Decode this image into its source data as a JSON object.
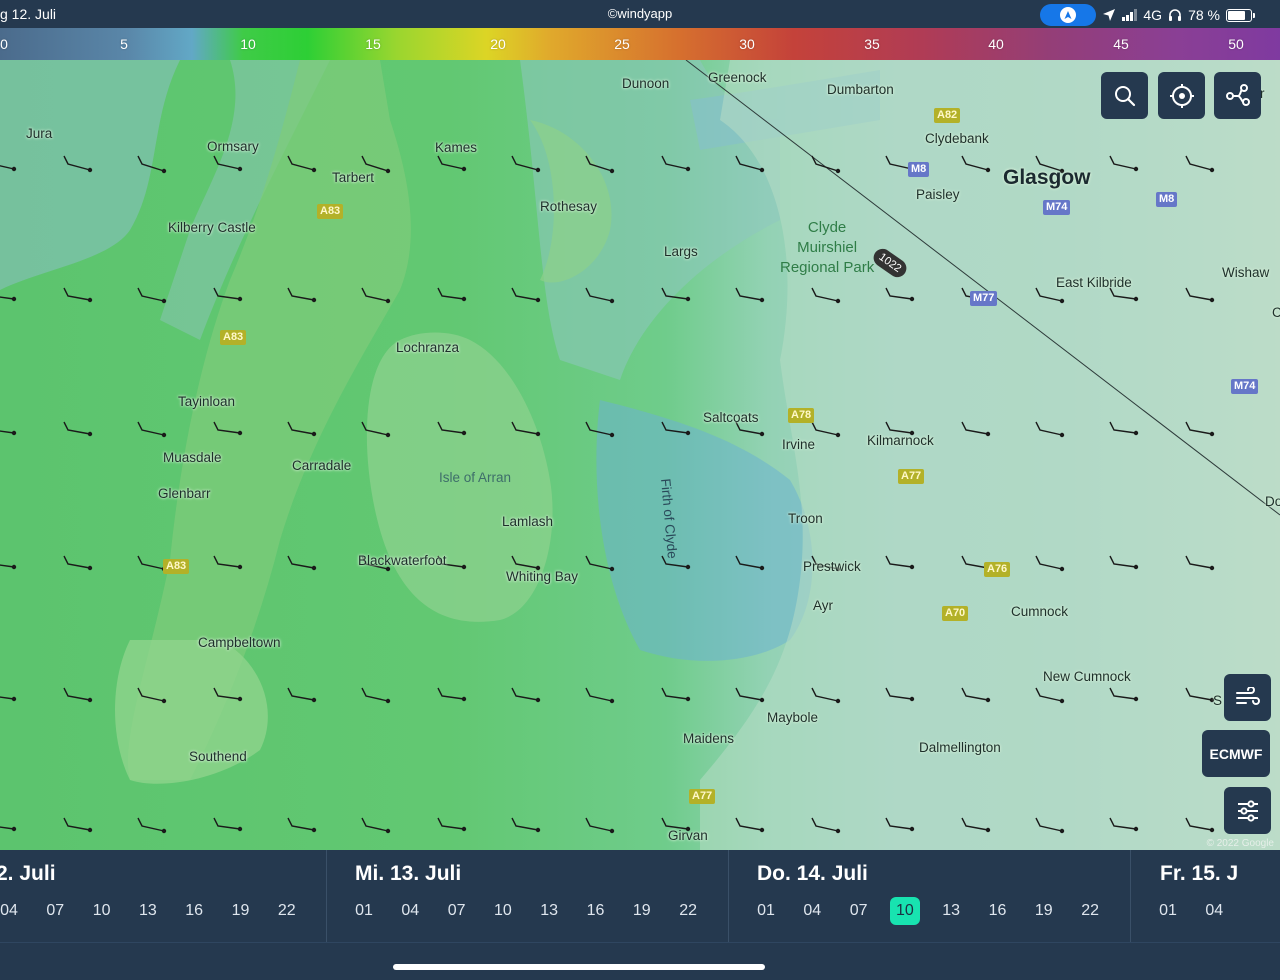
{
  "status_bar": {
    "date": "g 12. Juli",
    "brand": "©windyapp",
    "network": "4G",
    "battery": "78 %",
    "battery_level": 0.78
  },
  "legend": {
    "unit_hint": "",
    "ticks": [
      "0",
      "5",
      "10",
      "15",
      "20",
      "25",
      "30",
      "35",
      "40",
      "45",
      "50"
    ]
  },
  "map": {
    "places": {
      "jura": "Jura",
      "ormsary": "Ormsary",
      "tarbert": "Tarbert",
      "kames": "Kames",
      "dunoon": "Dunoon",
      "greenock": "Greenock",
      "dumbarton": "Dumbarton",
      "clydebank": "Clydebank",
      "glasgow": "Glasgow",
      "paisley": "Paisley",
      "rothesay": "Rothesay",
      "kilberry": "Kilberry Castle",
      "largs": "Largs",
      "park": "Clyde\nMuirshiel\nRegional Park",
      "east_kilbride": "East Kilbride",
      "wishaw": "Wishaw",
      "lochranza": "Lochranza",
      "tayinloan": "Tayinloan",
      "saltcoats": "Saltcoats",
      "irvine": "Irvine",
      "kilmarnock": "Kilmarnock",
      "muasdale": "Muasdale",
      "carradale": "Carradale",
      "arran": "Isle of Arran",
      "glenbarr": "Glenbarr",
      "lamlash": "Lamlash",
      "firth": "Firth of Clyde",
      "troon": "Troon",
      "blackwaterfoot": "Blackwaterfoot",
      "whiting_bay": "Whiting Bay",
      "prestwick": "Prestwick",
      "ayr": "Ayr",
      "cumnock": "Cumnock",
      "campbeltown": "Campbeltown",
      "new_cumnock": "New Cumnock",
      "maybole": "Maybole",
      "maidens": "Maidens",
      "dalmellington": "Dalmellington",
      "southend": "Southend",
      "girvan": "Girvan",
      "edge_do": "Do",
      "edge_s": "S",
      "edge_c": "C",
      "edge_r": "r"
    },
    "roads": {
      "a82": "A82",
      "m8a": "M8",
      "m8b": "M8",
      "m74a": "M74",
      "m74b": "M74",
      "a83a": "A83",
      "a83b": "A83",
      "a83c": "A83",
      "m77": "M77",
      "a78": "A78",
      "a77a": "A77",
      "a77b": "A77",
      "a76": "A76",
      "a70": "A70"
    },
    "isobar_value": "1022",
    "copyright": "© 2022 Google"
  },
  "controls": {
    "search_icon": "search-icon",
    "locate_icon": "crosshair-icon",
    "route_icon": "route-icon",
    "wind_icon": "wind-icon",
    "model_label": "ECMWF",
    "settings_icon": "sliders-icon"
  },
  "timeline": {
    "days": [
      {
        "label": "2. Juli",
        "hours": [
          "04",
          "07",
          "10",
          "13",
          "16",
          "19",
          "22"
        ]
      },
      {
        "label": "Mi. 13. Juli",
        "hours": [
          "01",
          "04",
          "07",
          "10",
          "13",
          "16",
          "19",
          "22"
        ]
      },
      {
        "label": "Do. 14. Juli",
        "hours": [
          "01",
          "04",
          "07",
          "10",
          "13",
          "16",
          "19",
          "22"
        ]
      },
      {
        "label": "Fr. 15. J",
        "hours": [
          "01",
          "04"
        ]
      }
    ],
    "selected": {
      "day": "Do. 14. Juli",
      "hour": "10"
    }
  },
  "colors": {
    "panel": "#25394f",
    "selected_hour": "#18e3b0",
    "road_a": "#b3b128",
    "road_m": "#6677c8"
  }
}
